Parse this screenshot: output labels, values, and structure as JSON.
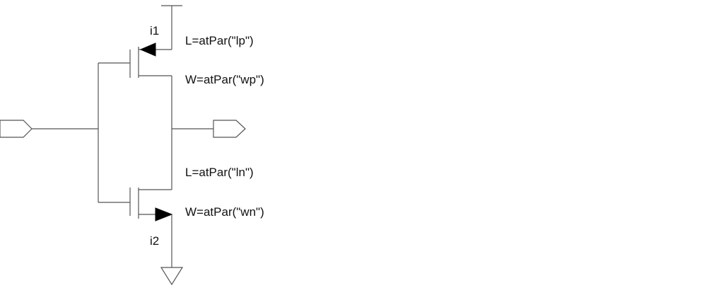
{
  "schematic": {
    "pmos": {
      "instance": "i1",
      "length_param": "L=atPar(\"lp\")",
      "width_param": "W=atPar(\"wp\")"
    },
    "nmos": {
      "instance": "i2",
      "length_param": "L=atPar(\"ln\")",
      "width_param": "W=atPar(\"wn\")"
    },
    "pins": {
      "input": "input-pin",
      "output": "output-pin"
    },
    "supplies": {
      "vdd": "vdd-symbol",
      "gnd": "ground-symbol"
    },
    "colors": {
      "wire": "#555555",
      "text": "#111111",
      "arrow": "#000000",
      "background": "#ffffff"
    }
  }
}
